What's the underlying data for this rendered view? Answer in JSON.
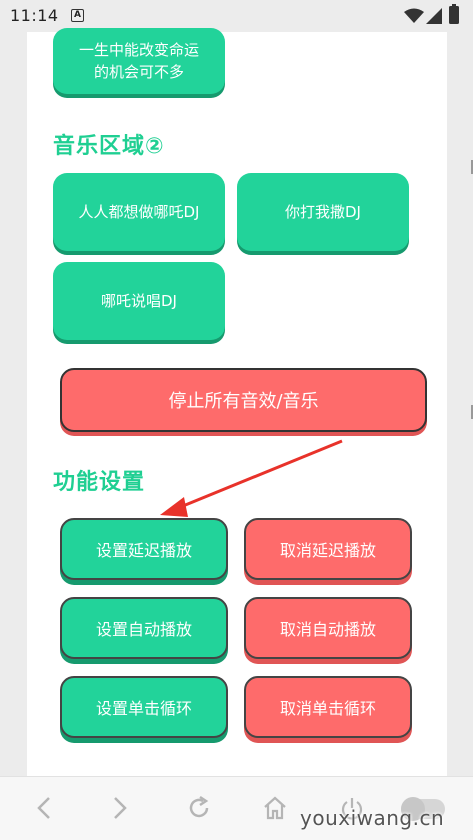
{
  "status_bar": {
    "time": "11:14",
    "notification_glyph": "A",
    "icons": [
      "wifi-icon",
      "signal-icon",
      "battery-icon"
    ]
  },
  "top_button": {
    "label_line1": "一生中能改变命运",
    "label_line2": "的机会可不多"
  },
  "music_section": {
    "title": "音乐区域②",
    "buttons": [
      {
        "label": "人人都想做哪吒DJ"
      },
      {
        "label": "你打我撒DJ"
      },
      {
        "label": "哪吒说唱DJ"
      }
    ]
  },
  "stop_button": {
    "label": "停止所有音效/音乐"
  },
  "function_section": {
    "title": "功能设置",
    "buttons": [
      {
        "label": "设置延迟播放"
      },
      {
        "label": "取消延迟播放"
      },
      {
        "label": "设置自动播放"
      },
      {
        "label": "取消自动播放"
      },
      {
        "label": "设置单击循环"
      },
      {
        "label": "取消单击循环"
      }
    ]
  },
  "bottom_nav": {
    "icons": [
      "back-icon",
      "forward-icon",
      "refresh-icon",
      "home-icon",
      "power-icon",
      "toggle-switch"
    ]
  },
  "watermark": {
    "text": "youxiwang.cn"
  },
  "colors": {
    "accent_green": "#22d39a",
    "title_green": "#1fcf92",
    "accent_red": "#fe6b6b",
    "annotation_arrow": "#e8322a"
  }
}
